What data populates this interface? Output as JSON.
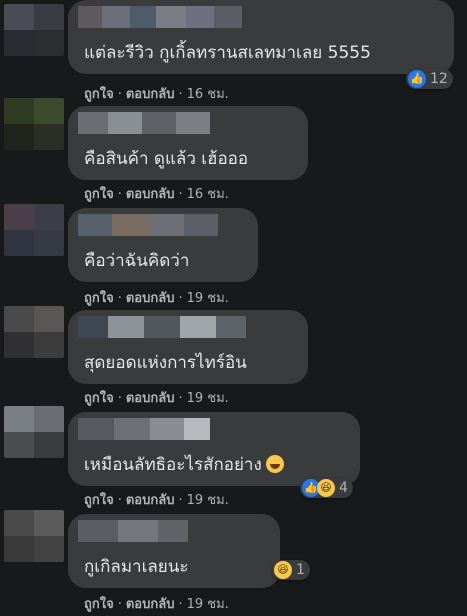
{
  "comments": [
    {
      "text": "แต่ละรีวิว กูเกิ้ลทรานสเลทมาเลย 5555",
      "like": "ถูกใจ",
      "reply": "ตอบกลับ",
      "time": "16 ชม.",
      "reaction_count": "12",
      "reaction_types": [
        "like"
      ],
      "avatar_colors": [
        "#4a4c55",
        "#3a3c44",
        "#2a2c33",
        "#2c2d30"
      ],
      "name_colors": [
        "#5f5a60",
        "#6a6f7a",
        "#4f5a6a",
        "#7a7d84",
        "#6c7080",
        "#5a5d66"
      ]
    },
    {
      "text": "คือสินค้า ดูแล้ว เฮ้อออ",
      "like": "ถูกใจ",
      "reply": "ตอบกลับ",
      "time": "16 ชม.",
      "avatar_colors": [
        "#2f3a22",
        "#3a4a2a",
        "#20241d",
        "#2a2e24"
      ],
      "name_colors": [
        "#6a6d72",
        "#8a8f96",
        "#5d6066",
        "#7b7f85"
      ]
    },
    {
      "text": "คือว่าฉันคิดว่า",
      "like": "ถูกใจ",
      "reply": "ตอบกลับ",
      "time": "19 ชม.",
      "avatar_colors": [
        "#4a3f48",
        "#3c3d46",
        "#2f3440",
        "#363a42"
      ],
      "name_colors": [
        "#55606a",
        "#7a6a60",
        "#6d6f74",
        "#5a5e66"
      ]
    },
    {
      "text": "สุดยอดแห่งการไทร์อิน",
      "like": "ถูกใจ",
      "reply": "ตอบกลับ",
      "time": "19 ชม.",
      "avatar_colors": [
        "#4b4a4a",
        "#5a5656",
        "#303032",
        "#3d3c3d"
      ],
      "name_colors": [
        "#3f4752",
        "#8d9399",
        "#52575e",
        "#a0a5aa",
        "#5e636a"
      ]
    },
    {
      "text": "เหมือนลัทธิอะไรสักอย่าง",
      "like": "ถูกใจ",
      "reply": "ตอบกลับ",
      "time": "19 ชม.",
      "reaction_count": "4",
      "reaction_types": [
        "like",
        "haha"
      ],
      "avatar_colors": [
        "#7a7e85",
        "#6a6d72",
        "#4a4c50",
        "#3a3b3e"
      ],
      "name_colors": [
        "#565a60",
        "#6d7177",
        "#8a8e94",
        "#b7bbc0"
      ]
    },
    {
      "text": "กูเกิลมาเลยนะ",
      "like": "ถูกใจ",
      "reply": "ตอบกลับ",
      "time": "19 ชม.",
      "reaction_count": "1",
      "reaction_types": [
        "haha"
      ],
      "avatar_colors": [
        "#4a4a4a",
        "#5b5b5b",
        "#3a3a3a",
        "#424242"
      ],
      "name_colors": [
        "#5a5d63",
        "#74787e",
        "#606368"
      ]
    }
  ]
}
